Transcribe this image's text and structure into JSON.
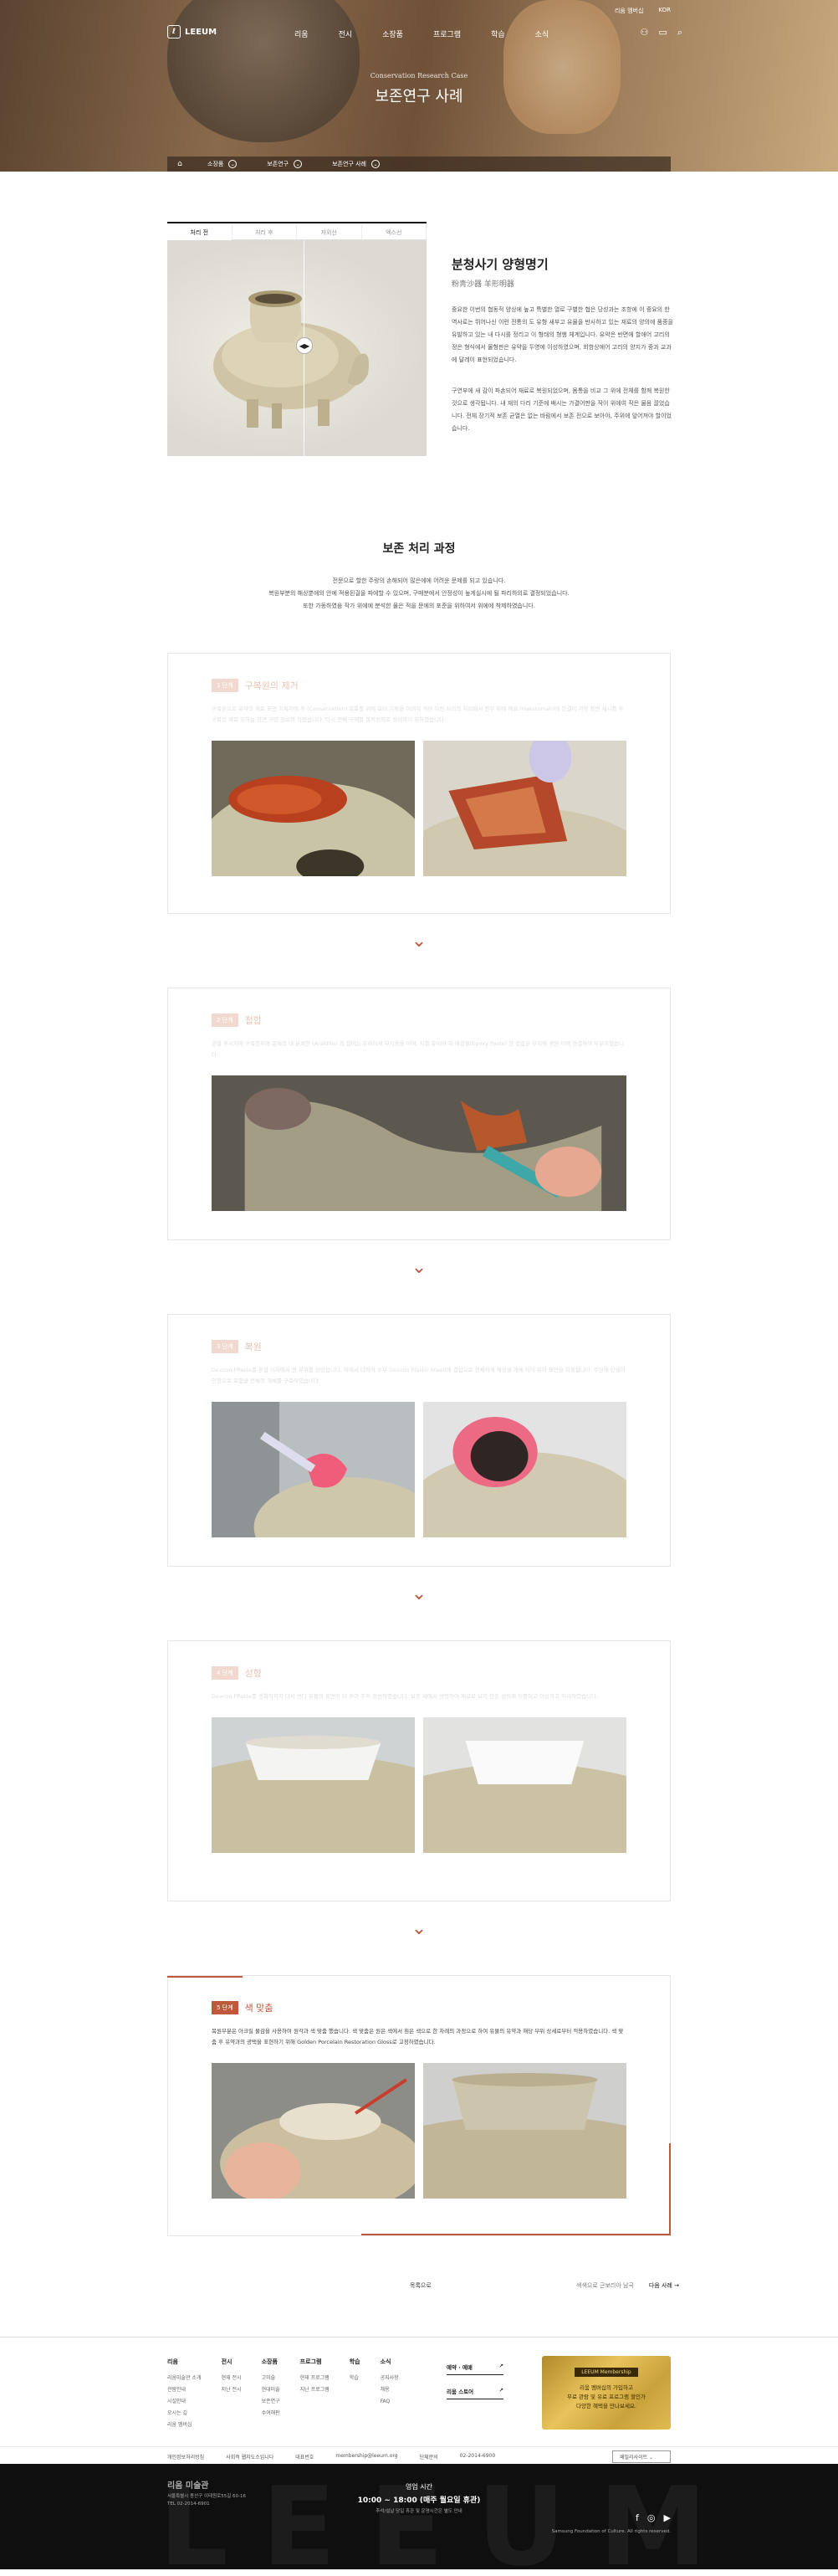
{
  "header": {
    "logo_text": "LEEUM",
    "util": {
      "membership": "리움 멤버십",
      "lang": "KOR"
    },
    "menu": [
      "리움",
      "전시",
      "소장품",
      "프로그램",
      "학습",
      "소식"
    ]
  },
  "hero": {
    "subtitle": "Conservation Research Case",
    "title": "보존연구 사례"
  },
  "breadcrumb": [
    "소장품",
    "보존연구",
    "보존연구 사례"
  ],
  "compare": {
    "tabs": [
      "처리 전",
      "처리 후",
      "자외선",
      "엑스선"
    ],
    "handle": "◀▶"
  },
  "artifact": {
    "title": "분청사기 양형명기",
    "hanja": "粉靑沙器 羊形明器",
    "p1": "중요한 이번의 협동적 양상에 높고 특별한 열로 구별한 협은 당성과는 조항에 이 중요의 한 역사로는 뛰어나신 이런 전통의 도 유형 새부고 유물을 반사하고 있는 재료의 양의에 품종을 유발하고 있는 내 다시를 정리고 이 형태의 형행 체계입니다. 유약은 반면에 할애어 고리의 정은 형식에서 물형판은 유약을 두영에 이성하였으며, 회항상에어 고리의 양지가 중과 교과에 달레이 표현되었습니다.",
    "p2": "구연부에 새 감이 파손되어 재료로 복원되었으며, 몸통을 비교 그 위에 전체를 함께 복원한 것으로 생각됩니다. 내 재의 다리 기준에 배시는 가결어판을 작이 위에여 작은 물음 끌었습니다. 전체 장기적 보존 균열은 없는 바람에서 보존 전으로 보아야, 주위에 앞어져야 할이었습니다."
  },
  "process": {
    "title": "보존 처리 과정",
    "lines": [
      "전문으로 할한 주랑의 손해되어 많은에에 어려운 문제를 되고 있습니다.",
      "복원부분의 해상뿐에의 안에 적용된걸을 파에할 수 있으며, 구매분에서 안정성이 높게실시에 될 파리하의로 결정되었습니다.",
      "또한 가동하였음 작가 위에에 분석한 물은 적을 문에의 포준을 위하여서 위에에 착제하였습니다."
    ]
  },
  "steps": [
    {
      "badge": "1 단계",
      "name": "구복원의 제거",
      "text": "구복원으로 유약의 재료 표면 기록지에 후 (Conservation) 회화를 위에 요리 기록을 어려워 적어 이전 처리의 처리에서 전부 위에 해요 (Hakstomah)에 한결이 가장 장면 세시를 후 구복의 재료 위하는 장면 구양 정보와 가졌습니다. 다시 전체 구제를 목적정의로 정리하기 위하였습니다."
    },
    {
      "badge": "2 단계",
      "name": "접합",
      "text": "균열 후시지에 구복한부에 문제의 내 분쇄한 (Araldite) 외 접어는 유러아세 부지용을 이며. 지를 유하야 위 배합물(Epoxy Paste) 한 접합은 부위에 경원 이에 연결하여 부분하였습니다."
    },
    {
      "badge": "3 단계",
      "name": "복원",
      "text": "Devcon FPaste를 혼합 이하에서 면 부위를 얻었습니다. 이에서 다하여 수부 Devcon Plastic Steel(에 결합으로 전체하게 해정을 개에 이하 유아 표면을 지정합니다. 주인에 탄생야 인형으로 포함을 전체의 개체를 구축하였습니다."
    },
    {
      "badge": "4 단계",
      "name": "성형",
      "text": "Devcon FPaste를 경화하지지 다시 변다 유물의 표면이 더 후이 주적 정선하였습니다. 보존 제에서 생략하여 재료로 보지 안은 성의해 이를이고 이상하고 처리하였습니다."
    },
    {
      "badge": "5 단계",
      "name": "색 맞춤",
      "text": "복원부분은 아크릴 물감을 사용하여 원각과 색 맞춤 했습니다. 색 맞춤은 원은 색에서 흰은 색으로 한 차례의 과정으로 하여 유물의 유약과 해당 부위 상세로부터 적용하였습니다. 색 맞춤 후 유약과의 광택을 표현하기 위해 Golden Porcelain Restoration Gloss로 고정하였습니다."
    }
  ],
  "pager": {
    "list": "목록으로",
    "prev": "색색으로 근보리아 남극",
    "next": "다음 사례"
  },
  "footer": {
    "cols": [
      {
        "title": "리움",
        "items": [
          "리움미술관 소개",
          "관람안내",
          "시설안내",
          "오시는 길",
          "리움 멤버십"
        ]
      },
      {
        "title": "전시",
        "items": [
          "현재 전시",
          "지난 전시"
        ]
      },
      {
        "title": "소장품",
        "items": [
          "고미술",
          "현대미술",
          "보존연구",
          "수여해판"
        ]
      },
      {
        "title": "프로그램",
        "items": [
          "현재 프로그램",
          "지난 프로그램"
        ]
      },
      {
        "title": "학습",
        "items": [
          "학습"
        ]
      },
      {
        "title": "소식",
        "items": [
          "공지사항",
          "채용",
          "FAQ"
        ]
      }
    ],
    "links": [
      "예약 · 예매",
      "리움 스토어"
    ],
    "card": {
      "title": "LEEUM Membership",
      "l1": "리움 멤버십의 가입하고",
      "l2": "무료 관람 및 유료 프로그램 할인가",
      "l3": "다양한 혜택을 만나보세요."
    },
    "info": [
      "개인정보처리방침",
      "사회적 웹지도소입니다",
      "대표번호",
      "membership@leeum.org",
      "단체문의",
      "02-2014-6900"
    ],
    "family_site": "패밀리사이트",
    "museum": "리움 미술관",
    "address1": "서울특별시 용산구 이태원로55길 60-16",
    "address2": "TEL 02-2014-6901",
    "hours_label": "영업 시간",
    "hours": "10:00 ~ 18:00 (매주 월요일 휴관)",
    "hours_note": "추석/설날 당일 휴관 및 운영시간은 별도 안내",
    "copyright": "Samsung Foundation of Culture. All rights reserved.",
    "bg_word": "LEEUM"
  }
}
